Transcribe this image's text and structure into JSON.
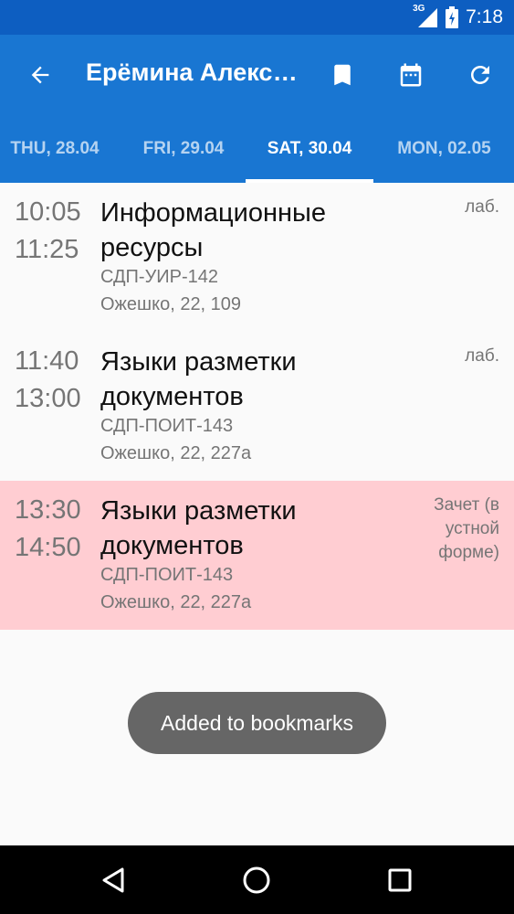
{
  "status_bar": {
    "network": "3G",
    "time": "7:18",
    "icons": [
      "signal-icon",
      "battery-icon"
    ]
  },
  "toolbar": {
    "title": "Ерёмина Александра",
    "actions": [
      "bookmark-icon",
      "calendar-icon",
      "refresh-icon"
    ]
  },
  "tabs": [
    {
      "label": "THU, 28.04"
    },
    {
      "label": "FRI, 29.04"
    },
    {
      "label": "SAT, 30.04"
    },
    {
      "label": "MON, 02.05"
    }
  ],
  "active_tab": "SAT, 30.04",
  "lessons": [
    {
      "start": "10:05",
      "end": "11:25",
      "subject": "Информационные ресурсы",
      "group": "СДП-УИР-142",
      "room": "Ожешко, 22, 109",
      "type": "лаб."
    },
    {
      "start": "11:40",
      "end": "13:00",
      "subject": "Языки разметки документов",
      "group": "СДП-ПОИТ-143",
      "room": "Ожешко, 22, 227а",
      "type": "лаб."
    },
    {
      "start": "13:30",
      "end": "14:50",
      "subject": "Языки разметки документов",
      "group": "СДП-ПОИТ-143",
      "room": "Ожешко, 22, 227а",
      "type": "Зачет (в устной форме)",
      "highlight_color": "#ffcdd2"
    }
  ],
  "toast": {
    "message": "Added to bookmarks"
  },
  "colors": {
    "primary": "#1976d2",
    "primary_dark": "#0d5ec1",
    "exam_highlight": "#ffcdd2"
  }
}
